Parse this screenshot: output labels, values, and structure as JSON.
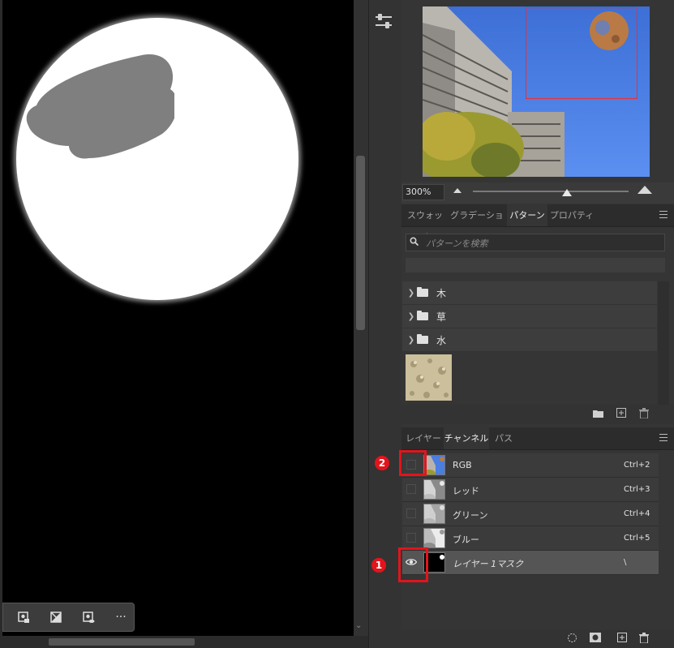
{
  "navigator": {
    "zoom_value": "300%"
  },
  "canvas_toolbar": {
    "more_label": "···"
  },
  "pattern_panel": {
    "tabs": [
      "スウォッチ",
      "グラデーション",
      "パターン",
      "プロパティ"
    ],
    "active_tab": "パターン",
    "search_placeholder": "パターンを検索",
    "folders": [
      "木",
      "草",
      "水"
    ]
  },
  "channels_panel": {
    "tabs": [
      "レイヤー",
      "チャンネル",
      "パス"
    ],
    "active_tab": "チャンネル",
    "channels": [
      {
        "name": "RGB",
        "shortcut": "Ctrl+2",
        "visible": false,
        "selected": false
      },
      {
        "name": "レッド",
        "shortcut": "Ctrl+3",
        "visible": false,
        "selected": false
      },
      {
        "name": "グリーン",
        "shortcut": "Ctrl+4",
        "visible": false,
        "selected": false
      },
      {
        "name": "ブルー",
        "shortcut": "Ctrl+5",
        "visible": false,
        "selected": false
      },
      {
        "name": "レイヤー 1マスク",
        "shortcut": "\\",
        "visible": true,
        "selected": true
      }
    ]
  },
  "annotations": {
    "badge_1": "1",
    "badge_2": "2",
    "color": "#e2141c"
  }
}
